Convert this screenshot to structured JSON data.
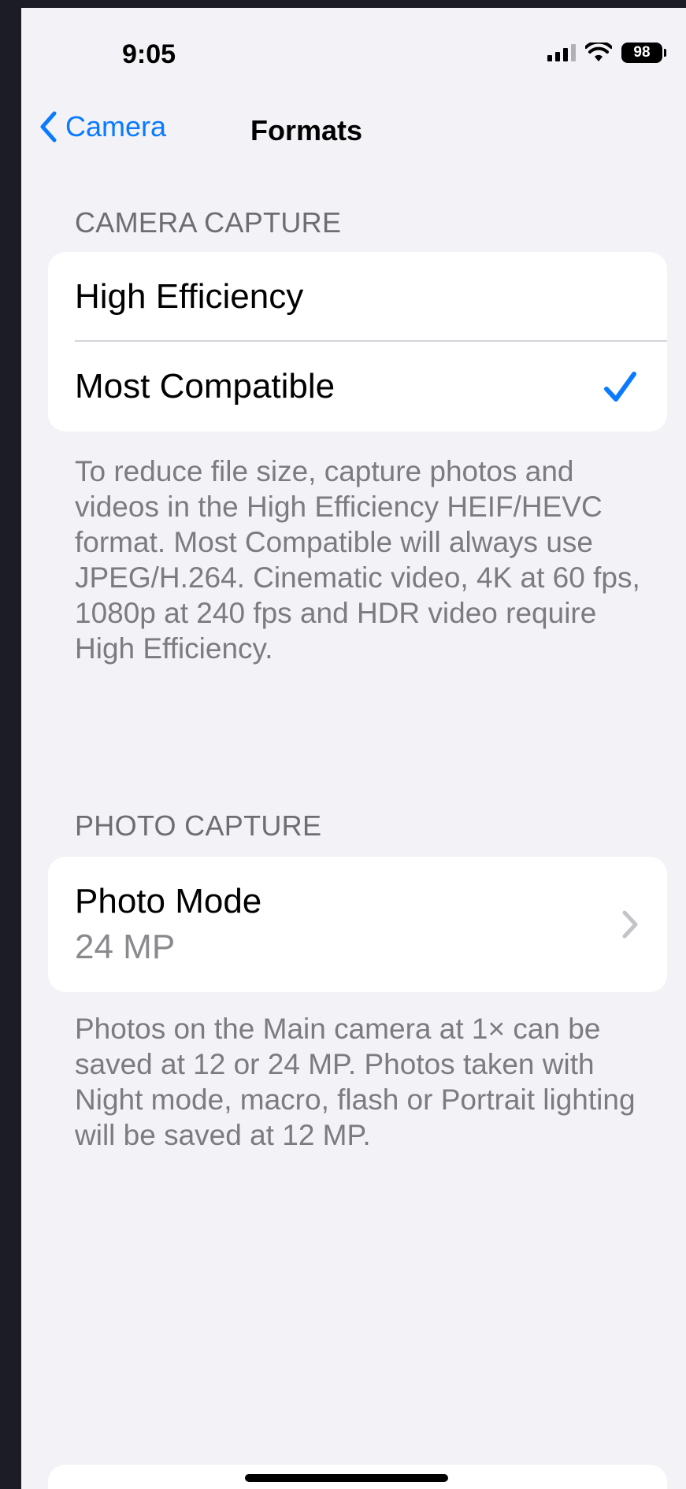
{
  "status_bar": {
    "time": "9:05",
    "battery": "98"
  },
  "nav": {
    "back_label": "Camera",
    "title": "Formats"
  },
  "camera_capture": {
    "header": "CAMERA CAPTURE",
    "options": [
      {
        "label": "High Efficiency",
        "selected": false
      },
      {
        "label": "Most Compatible",
        "selected": true
      }
    ],
    "footer": "To reduce file size, capture photos and videos in the High Efficiency HEIF/HEVC format. Most Compatible will always use JPEG/H.264. Cinematic video, 4K at 60 fps, 1080p at 240 fps and HDR video require High Efficiency."
  },
  "photo_capture": {
    "header": "PHOTO CAPTURE",
    "row": {
      "label": "Photo Mode",
      "value": "24 MP"
    },
    "footer": "Photos on the Main camera at 1× can be saved at 12 or 24 MP. Photos taken with Night mode, macro, flash or Portrait lighting will be saved at 12 MP."
  },
  "colors": {
    "accent": "#0a7aff",
    "background": "#f2f2f7",
    "secondary_text": "#6d6d72"
  },
  "icons": [
    "signal-icon",
    "wifi-icon",
    "battery-icon",
    "back-chevron-icon",
    "checkmark-icon",
    "chevron-right-icon"
  ]
}
